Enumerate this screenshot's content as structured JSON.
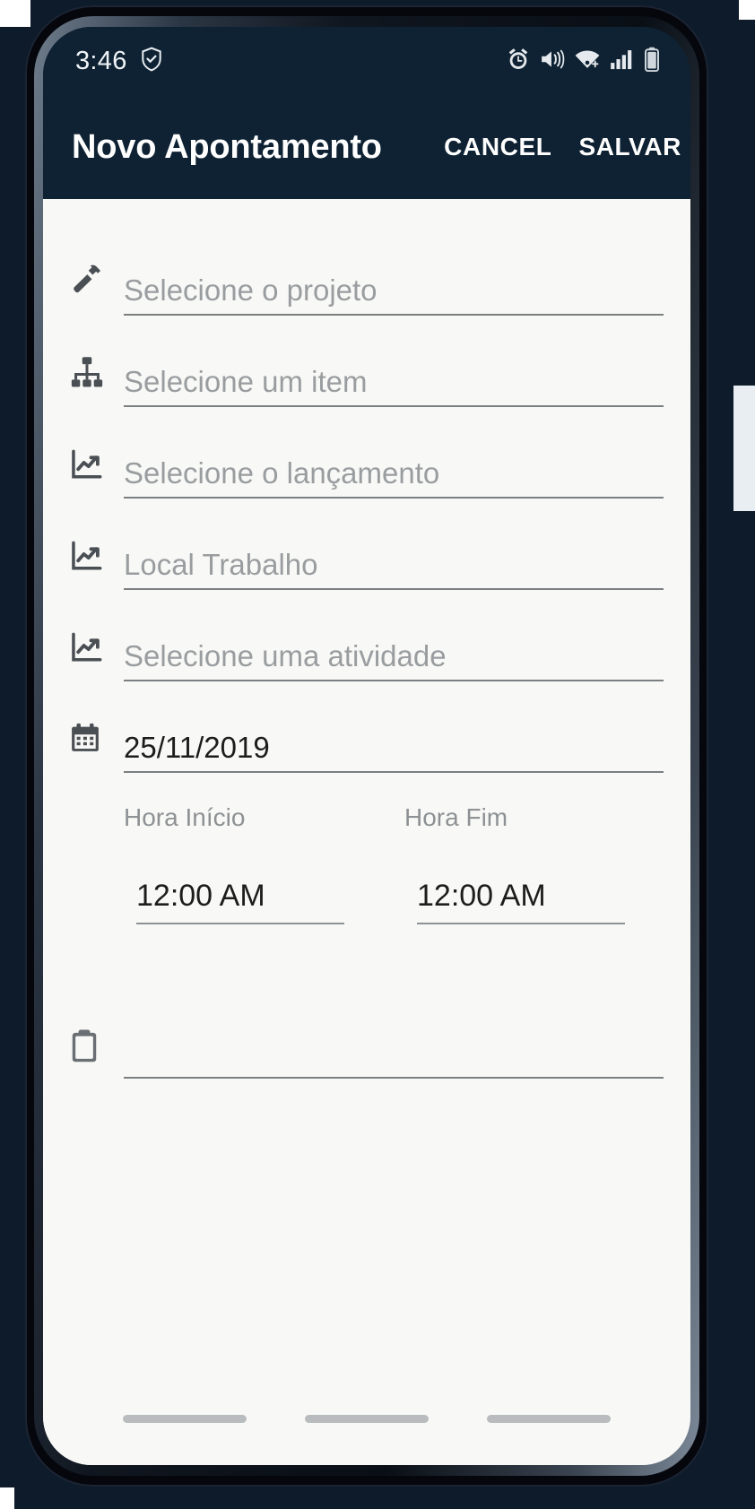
{
  "status_bar": {
    "time": "3:46",
    "left_icons": [
      {
        "name": "shield-check-icon",
        "glyph": "shield"
      }
    ],
    "right_icons": [
      {
        "name": "alarm-icon",
        "glyph": "alarm"
      },
      {
        "name": "vibrate-mute-icon",
        "glyph": "mute"
      },
      {
        "name": "wifi-icon",
        "glyph": "wifi"
      },
      {
        "name": "cellular-signal-icon",
        "glyph": "signal"
      },
      {
        "name": "battery-icon",
        "glyph": "battery"
      }
    ]
  },
  "app_bar": {
    "title": "Novo Apontamento",
    "cancel_label": "CANCEL",
    "save_label": "SALVAR",
    "background_color": "#0e2233",
    "text_color": "#ffffff"
  },
  "form": {
    "fields": [
      {
        "icon": "hammer-icon",
        "name": "project",
        "placeholder": "Selecione o projeto",
        "value": ""
      },
      {
        "icon": "account-tree-icon",
        "name": "item",
        "placeholder": "Selecione um item",
        "value": ""
      },
      {
        "icon": "trending-up-icon",
        "name": "entry",
        "placeholder": "Selecione o lançamento",
        "value": ""
      },
      {
        "icon": "trending-up-icon",
        "name": "worksite",
        "placeholder": "Local Trabalho",
        "value": ""
      },
      {
        "icon": "trending-up-icon",
        "name": "activity",
        "placeholder": "Selecione uma atividade",
        "value": ""
      },
      {
        "icon": "calendar-icon",
        "name": "date",
        "placeholder": "",
        "value": "25/11/2019"
      }
    ],
    "time": {
      "start": {
        "label": "Hora Início",
        "value": "12:00 AM"
      },
      "end": {
        "label": "Hora Fim",
        "value": "12:00 AM"
      }
    },
    "note": {
      "icon": "clipboard-icon",
      "name": "note",
      "placeholder": "",
      "value": ""
    }
  },
  "colors": {
    "surface": "#f8f9f6",
    "appbar": "#0e2233",
    "placeholder_text": "#9a9da0",
    "filled_text": "#1d1d1d",
    "underline": "#7b7f82",
    "icon": "#4a4f54"
  }
}
